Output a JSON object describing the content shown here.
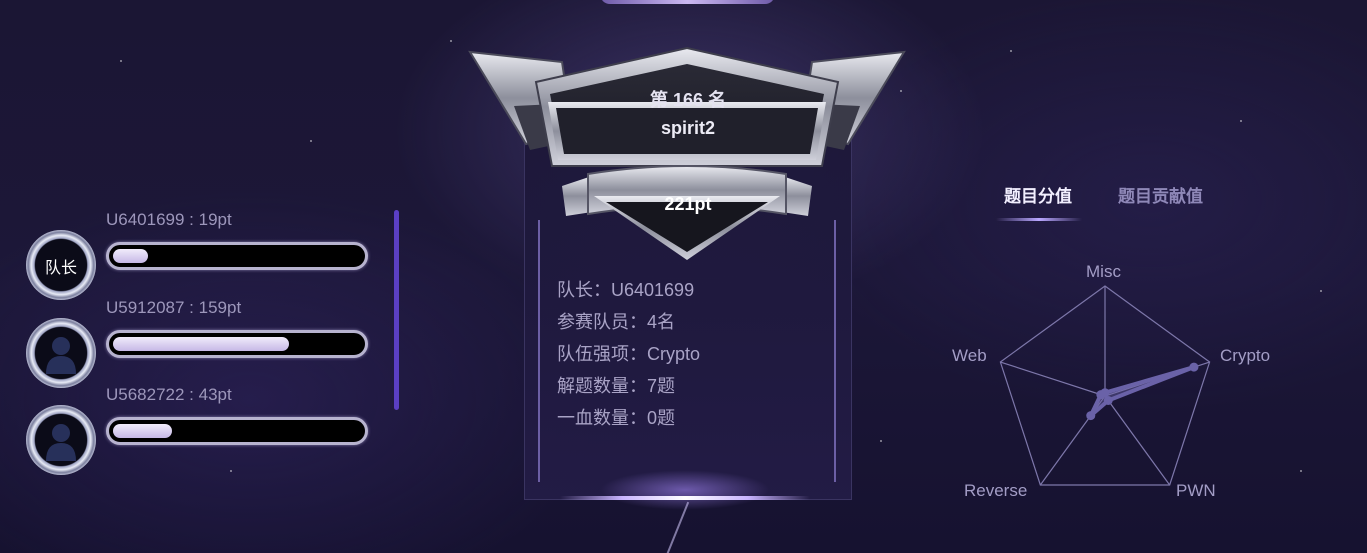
{
  "team_card": {
    "rank": "第 166 名",
    "team_name": "spirit2",
    "score": "221pt",
    "info": [
      "队长：U6401699",
      "参赛队员：4名",
      "队伍强项：Crypto",
      "解题数量：7题",
      "一血数量：0题"
    ]
  },
  "members": [
    {
      "label": "U6401699 : 19pt",
      "is_captain": true,
      "captain_text": "队长",
      "points": 19
    },
    {
      "label": "U5912087 : 159pt",
      "is_captain": false,
      "points": 159
    },
    {
      "label": "U5682722 : 43pt",
      "is_captain": false,
      "points": 43
    }
  ],
  "radar": {
    "tabs": [
      "题目分值",
      "题目贡献值"
    ],
    "active_tab": 0,
    "axes": [
      "Misc",
      "Crypto",
      "PWN",
      "Reverse",
      "Web"
    ],
    "values": [
      0.03,
      0.85,
      0.05,
      0.22,
      0.04
    ]
  },
  "colors": {
    "accent": "#5b3fc4",
    "bar_fill": "#d9cdf2",
    "radar_line": "#6a62a8",
    "background": "#1b1634"
  }
}
